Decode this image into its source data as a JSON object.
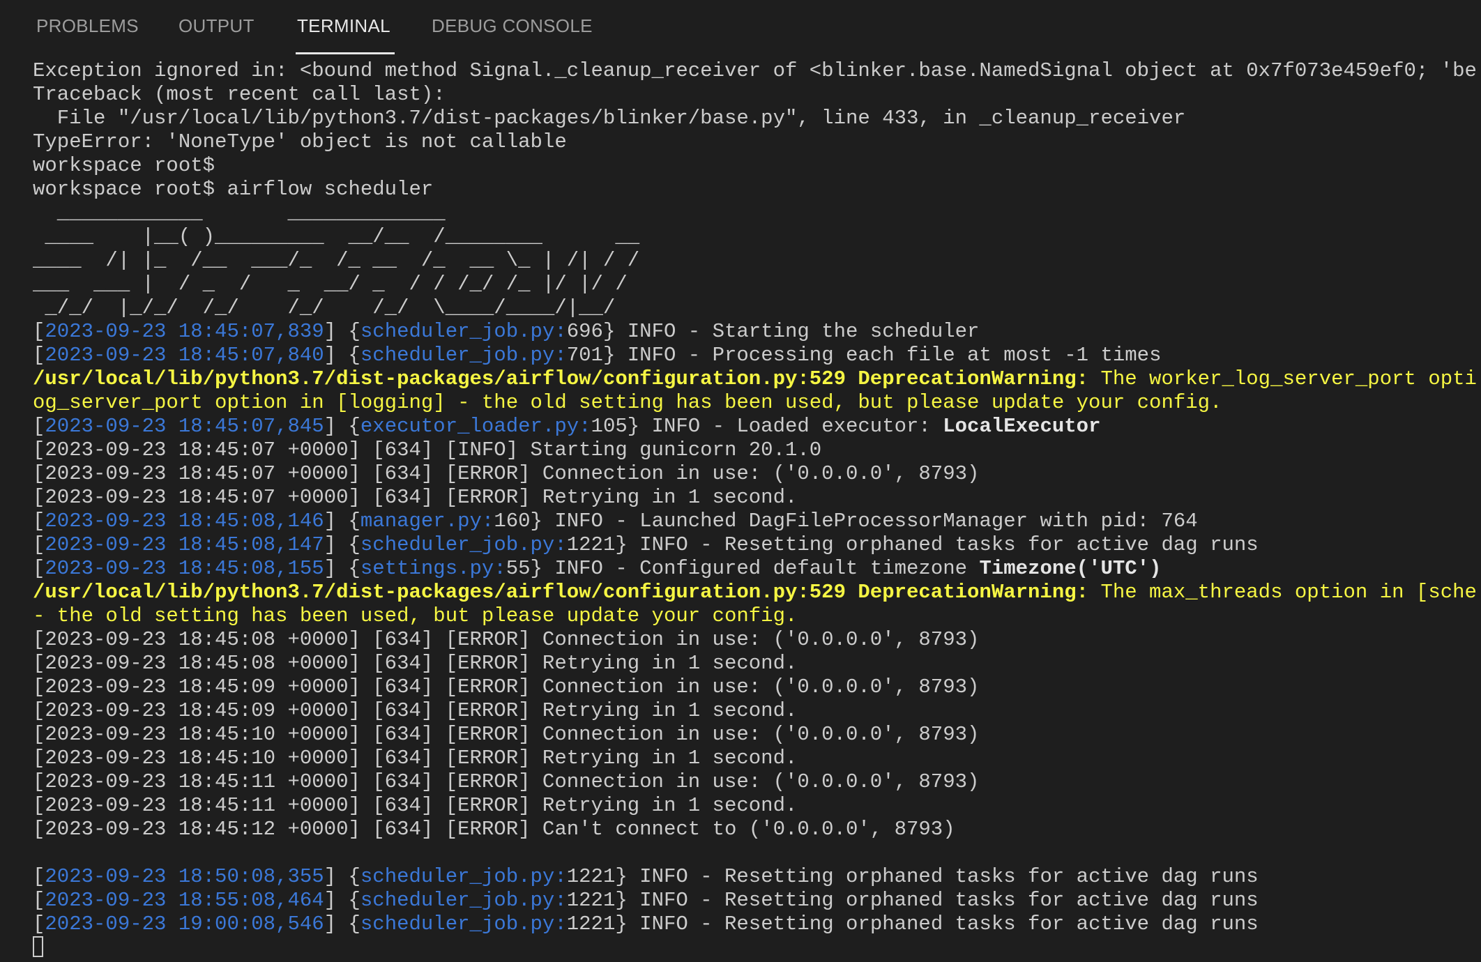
{
  "tabs": [
    {
      "label": "PROBLEMS",
      "active": false
    },
    {
      "label": "OUTPUT",
      "active": false
    },
    {
      "label": "TERMINAL",
      "active": true
    },
    {
      "label": "DEBUG CONSOLE",
      "active": false
    }
  ],
  "colors": {
    "background": "#1e1e1e",
    "text": "#cccccc",
    "blue": "#3b78d8",
    "yellow": "#f5f543"
  },
  "lines": [
    [
      [
        "n",
        "Exception ignored in: <bound method Signal._cleanup_receiver of <blinker.base.NamedSignal object at 0x7f073e459ef0; 'be"
      ]
    ],
    [
      [
        "n",
        "Traceback (most recent call last):"
      ]
    ],
    [
      [
        "n",
        "  File \"/usr/local/lib/python3.7/dist-packages/blinker/base.py\", line 433, in _cleanup_receiver"
      ]
    ],
    [
      [
        "n",
        "TypeError: 'NoneType' object is not callable"
      ]
    ],
    [
      [
        "n",
        "workspace root$ "
      ]
    ],
    [
      [
        "n",
        "workspace root$ airflow scheduler"
      ]
    ],
    [
      [
        "n",
        "  ____________       _____________"
      ]
    ],
    [
      [
        "n",
        " ____    |__( )_________  __/__  /________      __"
      ]
    ],
    [
      [
        "n",
        "____  /| |_  /__  ___/_  /_ __  /_  __ \\_ | /| / /"
      ]
    ],
    [
      [
        "n",
        "___  ___ |  / _  /   _  __/ _  / / /_/ /_ |/ |/ /"
      ]
    ],
    [
      [
        "n",
        " _/_/  |_/_/  /_/    /_/    /_/  \\____/____/|__/"
      ]
    ],
    [
      [
        "n",
        "["
      ],
      [
        "b",
        "2023-09-23 18:45:07,839"
      ],
      [
        "n",
        "] {"
      ],
      [
        "b",
        "scheduler_job.py:"
      ],
      [
        "n",
        "696} INFO - Starting the scheduler"
      ]
    ],
    [
      [
        "n",
        "["
      ],
      [
        "b",
        "2023-09-23 18:45:07,840"
      ],
      [
        "n",
        "] {"
      ],
      [
        "b",
        "scheduler_job.py:"
      ],
      [
        "n",
        "701} INFO - Processing each file at most -1 times"
      ]
    ],
    [
      [
        "y",
        "/usr/local/lib/python3.7/dist-packages/airflow/configuration.py:529 DeprecationWarning:"
      ],
      [
        "yn",
        " The worker_log_server_port opti"
      ]
    ],
    [
      [
        "yn",
        "og_server_port option in [logging] - the old setting has been used, but please update your config."
      ]
    ],
    [
      [
        "n",
        "["
      ],
      [
        "b",
        "2023-09-23 18:45:07,845"
      ],
      [
        "n",
        "] {"
      ],
      [
        "b",
        "executor_loader.py:"
      ],
      [
        "n",
        "105} INFO - Loaded executor: "
      ],
      [
        "w",
        "LocalExecutor"
      ]
    ],
    [
      [
        "n",
        "[2023-09-23 18:45:07 +0000] [634] [INFO] Starting gunicorn 20.1.0"
      ]
    ],
    [
      [
        "n",
        "[2023-09-23 18:45:07 +0000] [634] [ERROR] Connection in use: ('0.0.0.0', 8793)"
      ]
    ],
    [
      [
        "n",
        "[2023-09-23 18:45:07 +0000] [634] [ERROR] Retrying in 1 second."
      ]
    ],
    [
      [
        "n",
        "["
      ],
      [
        "b",
        "2023-09-23 18:45:08,146"
      ],
      [
        "n",
        "] {"
      ],
      [
        "b",
        "manager.py:"
      ],
      [
        "n",
        "160} INFO - Launched DagFileProcessorManager with pid: 764"
      ]
    ],
    [
      [
        "n",
        "["
      ],
      [
        "b",
        "2023-09-23 18:45:08,147"
      ],
      [
        "n",
        "] {"
      ],
      [
        "b",
        "scheduler_job.py:"
      ],
      [
        "n",
        "1221} INFO - Resetting orphaned tasks for active dag runs"
      ]
    ],
    [
      [
        "n",
        "["
      ],
      [
        "b",
        "2023-09-23 18:45:08,155"
      ],
      [
        "n",
        "] {"
      ],
      [
        "b",
        "settings.py:"
      ],
      [
        "n",
        "55} INFO - Configured default timezone "
      ],
      [
        "w",
        "Timezone('UTC')"
      ]
    ],
    [
      [
        "y",
        "/usr/local/lib/python3.7/dist-packages/airflow/configuration.py:529 DeprecationWarning:"
      ],
      [
        "yn",
        " The max_threads option in [sche"
      ]
    ],
    [
      [
        "yn",
        "- the old setting has been used, but please update your config."
      ]
    ],
    [
      [
        "n",
        "[2023-09-23 18:45:08 +0000] [634] [ERROR] Connection in use: ('0.0.0.0', 8793)"
      ]
    ],
    [
      [
        "n",
        "[2023-09-23 18:45:08 +0000] [634] [ERROR] Retrying in 1 second."
      ]
    ],
    [
      [
        "n",
        "[2023-09-23 18:45:09 +0000] [634] [ERROR] Connection in use: ('0.0.0.0', 8793)"
      ]
    ],
    [
      [
        "n",
        "[2023-09-23 18:45:09 +0000] [634] [ERROR] Retrying in 1 second."
      ]
    ],
    [
      [
        "n",
        "[2023-09-23 18:45:10 +0000] [634] [ERROR] Connection in use: ('0.0.0.0', 8793)"
      ]
    ],
    [
      [
        "n",
        "[2023-09-23 18:45:10 +0000] [634] [ERROR] Retrying in 1 second."
      ]
    ],
    [
      [
        "n",
        "[2023-09-23 18:45:11 +0000] [634] [ERROR] Connection in use: ('0.0.0.0', 8793)"
      ]
    ],
    [
      [
        "n",
        "[2023-09-23 18:45:11 +0000] [634] [ERROR] Retrying in 1 second."
      ]
    ],
    [
      [
        "n",
        "[2023-09-23 18:45:12 +0000] [634] [ERROR] Can't connect to ('0.0.0.0', 8793)"
      ]
    ],
    [
      [
        "n",
        ""
      ]
    ],
    [
      [
        "n",
        "["
      ],
      [
        "b",
        "2023-09-23 18:50:08,355"
      ],
      [
        "n",
        "] {"
      ],
      [
        "b",
        "scheduler_job.py:"
      ],
      [
        "n",
        "1221} INFO - Resetting orphaned tasks for active dag runs"
      ]
    ],
    [
      [
        "n",
        "["
      ],
      [
        "b",
        "2023-09-23 18:55:08,464"
      ],
      [
        "n",
        "] {"
      ],
      [
        "b",
        "scheduler_job.py:"
      ],
      [
        "n",
        "1221} INFO - Resetting orphaned tasks for active dag runs"
      ]
    ],
    [
      [
        "n",
        "["
      ],
      [
        "b",
        "2023-09-23 19:00:08,546"
      ],
      [
        "n",
        "] {"
      ],
      [
        "b",
        "scheduler_job.py:"
      ],
      [
        "n",
        "1221} INFO - Resetting orphaned tasks for active dag runs"
      ]
    ]
  ]
}
